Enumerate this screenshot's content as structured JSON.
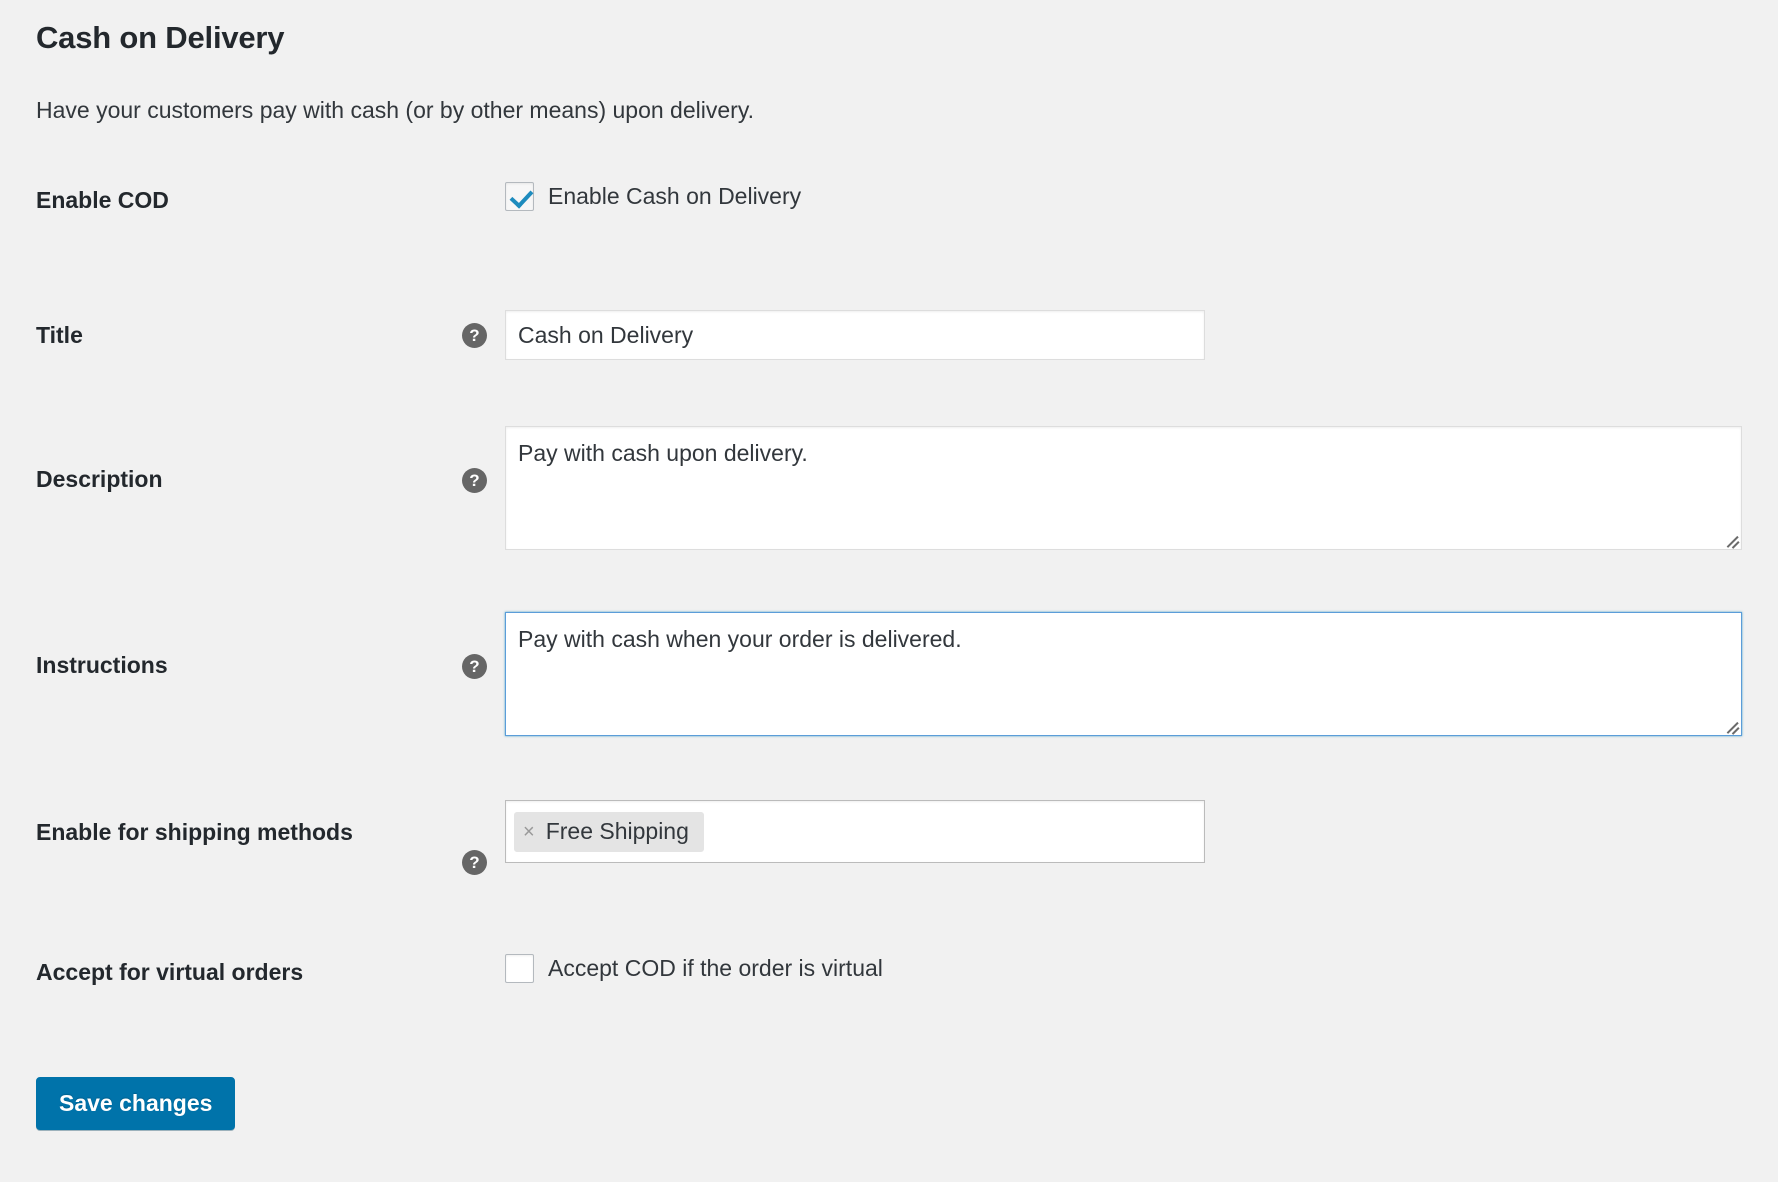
{
  "section": {
    "title": "Cash on Delivery",
    "description": "Have your customers pay with cash (or by other means) upon delivery."
  },
  "fields": {
    "enable_cod": {
      "label": "Enable COD",
      "checkbox_label": "Enable Cash on Delivery",
      "checked": true
    },
    "title": {
      "label": "Title",
      "value": "Cash on Delivery",
      "help_icon": "?"
    },
    "description": {
      "label": "Description",
      "value": "Pay with cash upon delivery.",
      "help_icon": "?"
    },
    "instructions": {
      "label": "Instructions",
      "value": "Pay with cash when your order is delivered.",
      "help_icon": "?",
      "focused": true
    },
    "shipping_methods": {
      "label": "Enable for shipping methods",
      "help_icon": "?",
      "tags": [
        {
          "label": "Free Shipping",
          "remove_icon": "×"
        }
      ]
    },
    "virtual_orders": {
      "label": "Accept for virtual orders",
      "checkbox_label": "Accept COD if the order is virtual",
      "checked": false
    }
  },
  "actions": {
    "save_label": "Save changes"
  },
  "colors": {
    "page_background": "#f1f1f1",
    "label_text": "#23282d",
    "body_text": "#32373c",
    "primary_button": "#0073aa",
    "checkbox_accent": "#1e8cbe",
    "focus_border": "#5b9dd9",
    "help_icon_bg": "#666666",
    "tag_background": "#e4e4e4"
  }
}
